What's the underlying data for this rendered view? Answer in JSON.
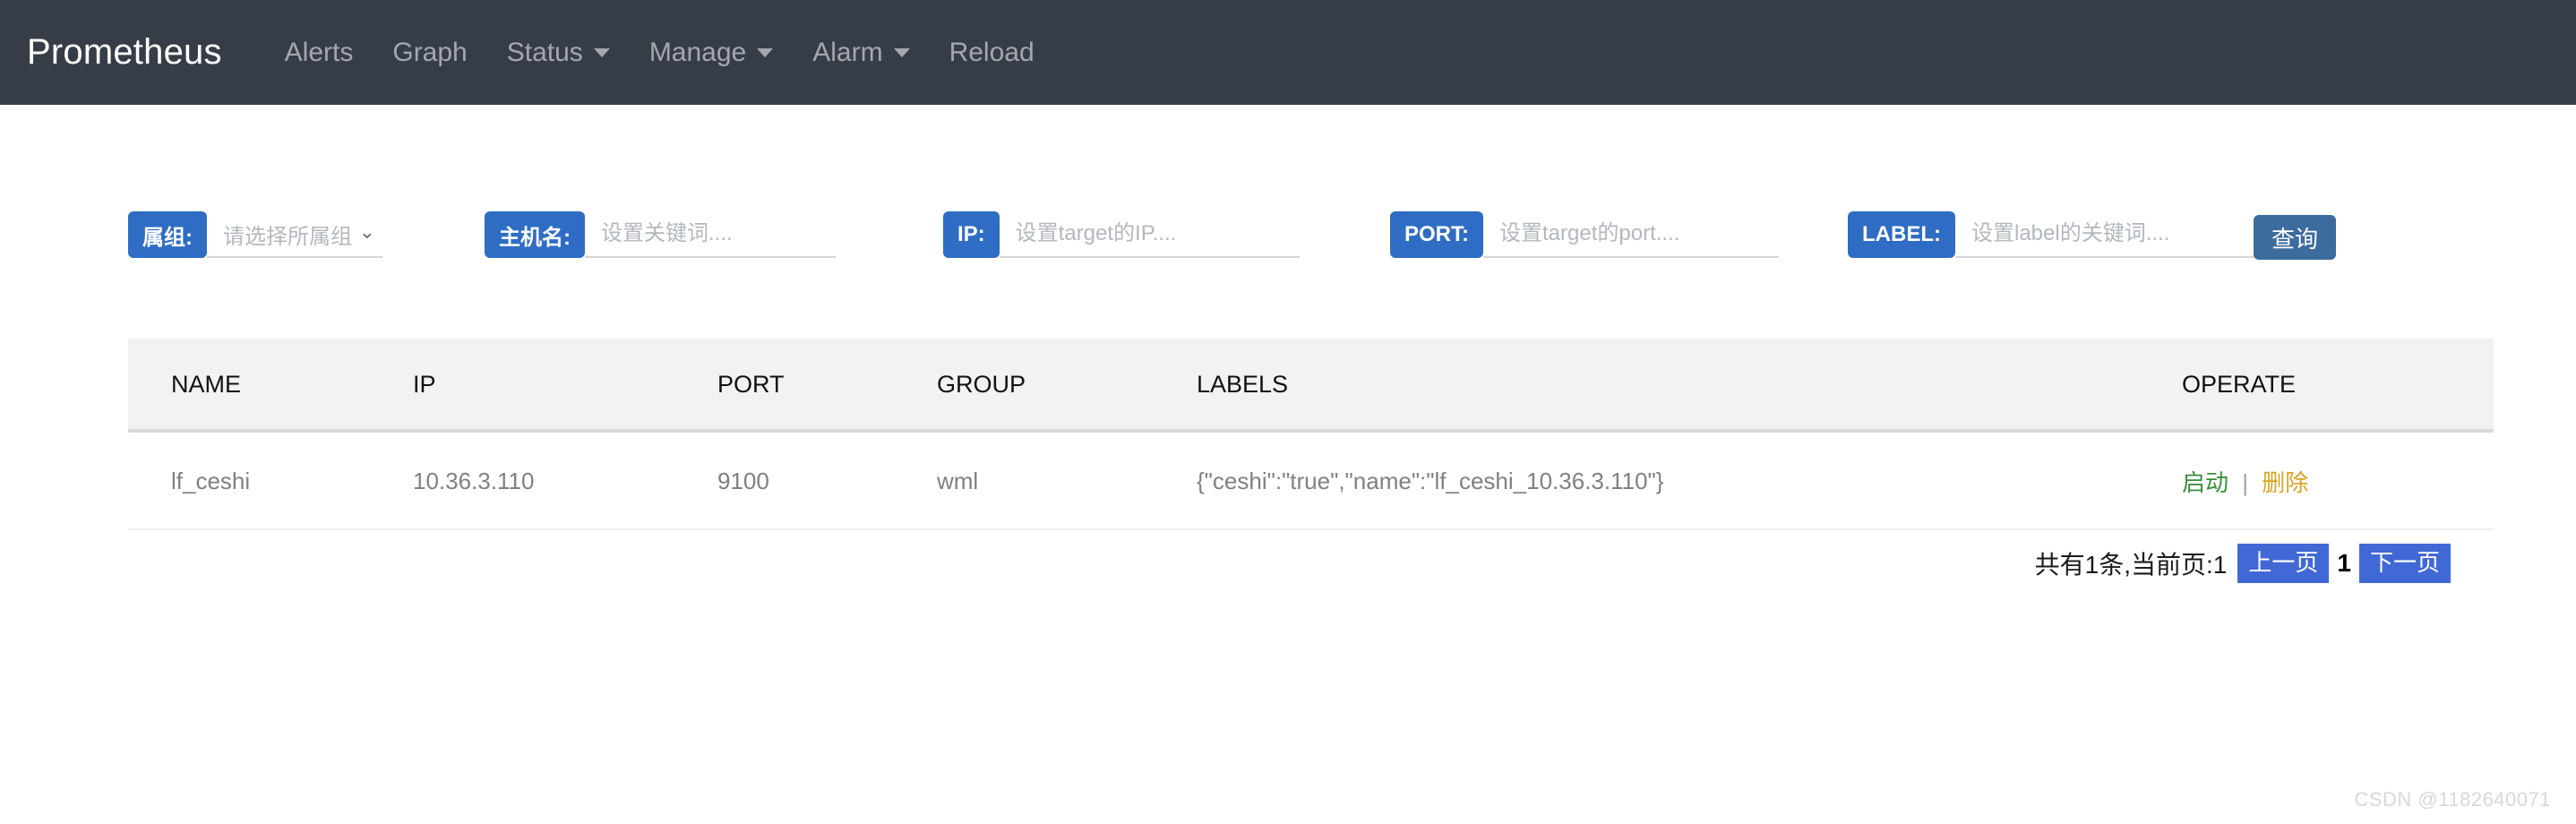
{
  "navbar": {
    "brand": "Prometheus",
    "items": [
      {
        "label": "Alerts",
        "has_caret": false
      },
      {
        "label": "Graph",
        "has_caret": false
      },
      {
        "label": "Status",
        "has_caret": true
      },
      {
        "label": "Manage",
        "has_caret": true
      },
      {
        "label": "Alarm",
        "has_caret": true
      },
      {
        "label": "Reload",
        "has_caret": false
      }
    ],
    "background_color": "#373d47",
    "brand_color": "#ffffff",
    "item_color": "#a3a8af"
  },
  "filters": {
    "group": {
      "label": "属组:",
      "placeholder": "请选择所属组",
      "value": "",
      "caret": "⌄"
    },
    "hostname": {
      "label": "主机名:",
      "placeholder": "设置关键词....",
      "value": ""
    },
    "ip": {
      "label": "IP:",
      "placeholder": "设置target的IP....",
      "value": ""
    },
    "port": {
      "label": "PORT:",
      "placeholder": "设置target的port....",
      "value": ""
    },
    "label": {
      "label": "LABEL:",
      "placeholder": "设置label的关键词....",
      "value": ""
    },
    "query_button": "查询",
    "label_color": "#2f6dc4",
    "query_button_color": "#3c6b9e"
  },
  "table": {
    "columns": [
      "NAME",
      "IP",
      "PORT",
      "GROUP",
      "LABELS",
      "OPERATE"
    ],
    "rows": [
      {
        "name": "lf_ceshi",
        "ip": "10.36.3.110",
        "port": "9100",
        "group": "wml",
        "labels": "{\"ceshi\":\"true\",\"name\":\"lf_ceshi_10.36.3.110\"}",
        "operate": {
          "start": "启动",
          "separator": "|",
          "delete": "删除",
          "start_color": "#3b8f3b",
          "delete_color": "#d9a321"
        }
      }
    ],
    "header_bg": "#f2f2f2"
  },
  "pagination": {
    "info": "共有1条,当前页:1",
    "prev": "上一页",
    "current_page": "1",
    "next": "下一页",
    "button_color": "#4169d6"
  },
  "watermark": "CSDN @1182640071"
}
